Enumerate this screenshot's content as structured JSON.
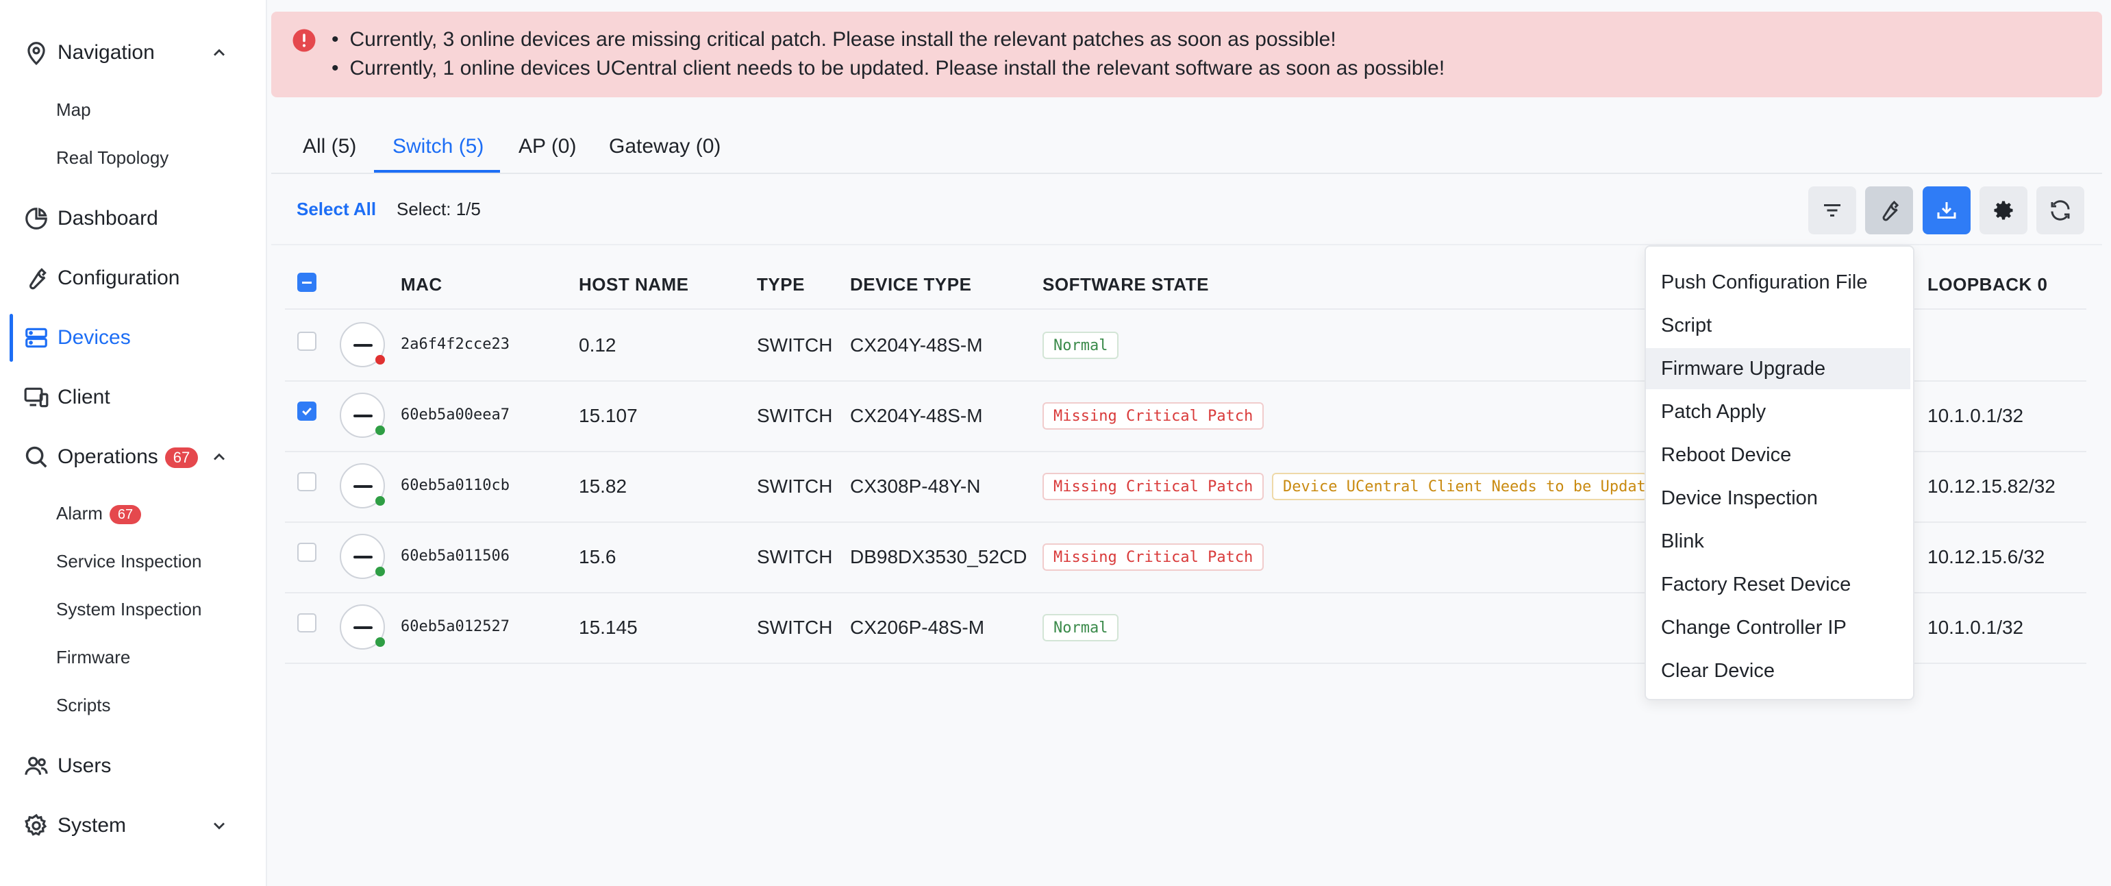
{
  "sidebar": {
    "navigation": "Navigation",
    "map": "Map",
    "real_topology": "Real Topology",
    "dashboard": "Dashboard",
    "configuration": "Configuration",
    "devices": "Devices",
    "client": "Client",
    "operations": "Operations",
    "operations_count": "67",
    "alarm": "Alarm",
    "alarm_count": "67",
    "service_inspection": "Service Inspection",
    "system_inspection": "System Inspection",
    "firmware": "Firmware",
    "scripts": "Scripts",
    "users": "Users",
    "system": "System"
  },
  "alert": {
    "line1": "Currently, 3 online devices are missing critical patch. Please install the relevant patches as soon as possible!",
    "line2": "Currently, 1 online devices UCentral client needs to be updated. Please install the relevant software as soon as possible!"
  },
  "tabs": [
    "All (5)",
    "Switch (5)",
    "AP (0)",
    "Gateway (0)"
  ],
  "toolbar": {
    "select_all": "Select All",
    "select_count": "Select: 1/5"
  },
  "table": {
    "headers": {
      "mac": "MAC",
      "host_name": "HOST NAME",
      "type": "TYPE",
      "device_type": "DEVICE TYPE",
      "software_state": "SOFTWARE STATE",
      "loopback": "LOOPBACK 0"
    },
    "rows": [
      {
        "mac": "2a6f4f2cce23",
        "host": "0.12",
        "type": "SWITCH",
        "device_type": "CX204Y-48S-M",
        "state1": "Normal",
        "state2": "",
        "loopback": "",
        "checked": false,
        "status": "offline"
      },
      {
        "mac": "60eb5a00eea7",
        "host": "15.107",
        "type": "SWITCH",
        "device_type": "CX204Y-48S-M",
        "state1": "Missing Critical Patch",
        "state2": "",
        "loopback": "10.1.0.1/32",
        "checked": true,
        "status": "online"
      },
      {
        "mac": "60eb5a0110cb",
        "host": "15.82",
        "type": "SWITCH",
        "device_type": "CX308P-48Y-N",
        "state1": "Missing Critical Patch",
        "state2": "Device UCentral Client Needs to be Updat",
        "loopback": "10.12.15.82/32",
        "checked": false,
        "status": "online"
      },
      {
        "mac": "60eb5a011506",
        "host": "15.6",
        "type": "SWITCH",
        "device_type": "DB98DX3530_52CD",
        "state1": "Missing Critical Patch",
        "state2": "",
        "loopback": "10.12.15.6/32",
        "checked": false,
        "status": "online"
      },
      {
        "mac": "60eb5a012527",
        "host": "15.145",
        "type": "SWITCH",
        "device_type": "CX206P-48S-M",
        "state1": "Normal",
        "state2": "",
        "loopback": "10.1.0.1/32",
        "checked": false,
        "status": "online"
      }
    ]
  },
  "menu": {
    "items": [
      "Push Configuration File",
      "Script",
      "Firmware Upgrade",
      "Patch Apply",
      "Reboot Device",
      "Device Inspection",
      "Blink",
      "Factory Reset Device",
      "Change Controller IP",
      "Clear Device"
    ],
    "highlighted": "Firmware Upgrade"
  },
  "colors": {
    "accent": "#1d6ef5",
    "alert_bg": "#f8d5d7",
    "danger": "#e5484d",
    "online": "#2f9e44",
    "offline": "#e03131"
  }
}
